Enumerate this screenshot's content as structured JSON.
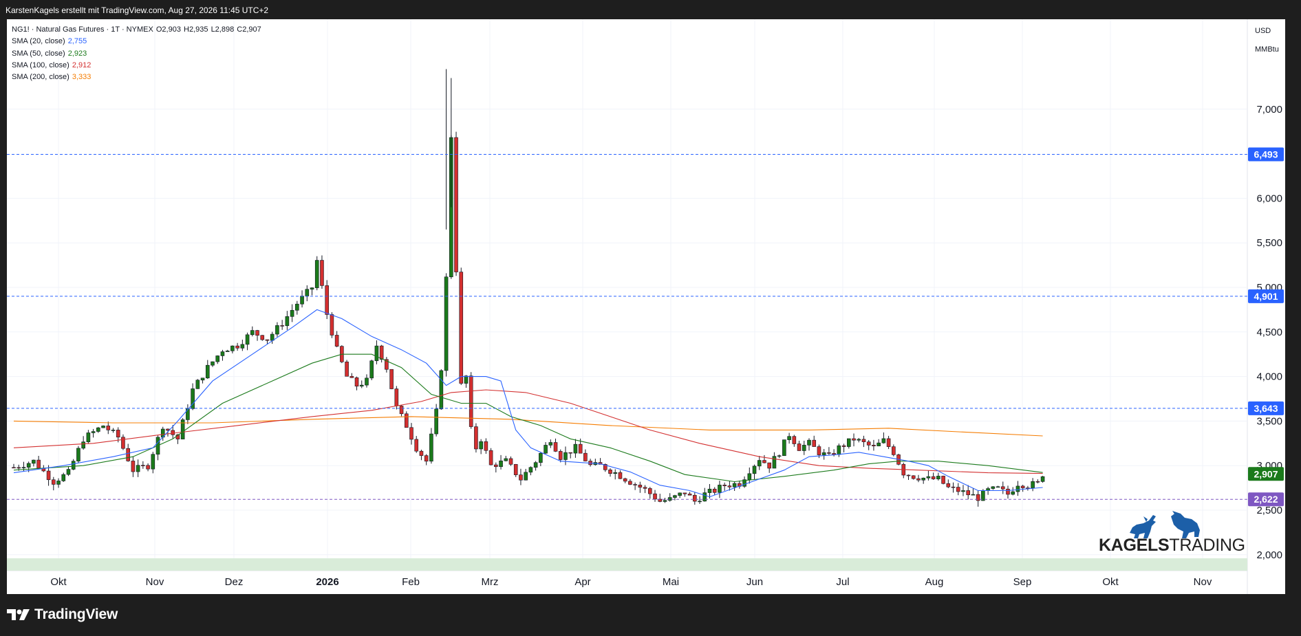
{
  "header": {
    "author_line": "KarstenKagels erstellt mit TradingView.com, Aug 27, 2026 11:45 UTC+2"
  },
  "legend": {
    "symbol": "NG1! · Natural Gas Futures · 1T · NYMEX",
    "open": "O2,903",
    "high": "H2,935",
    "low": "L2,898",
    "close": "C2,907",
    "sma": [
      {
        "label": "SMA (20, close)",
        "value": "2,755",
        "color": "#2962ff"
      },
      {
        "label": "SMA (50, close)",
        "value": "2,923",
        "color": "#1b7a1b"
      },
      {
        "label": "SMA (100, close)",
        "value": "2,912",
        "color": "#d32f2f"
      },
      {
        "label": "SMA (200, close)",
        "value": "3,333",
        "color": "#f57c00"
      }
    ]
  },
  "price_axis": {
    "currency": "USD",
    "unit": "MMBtu",
    "ticks": [
      "2,000",
      "2,500",
      "3,000",
      "3,500",
      "4,000",
      "4,500",
      "5,000",
      "5,500",
      "6,000",
      "7,000"
    ]
  },
  "time_axis": {
    "labels": [
      "Okt",
      "Nov",
      "Dez",
      "2026",
      "Feb",
      "Mrz",
      "Apr",
      "Mai",
      "Jun",
      "Jul",
      "Aug",
      "Sep",
      "Okt",
      "Nov"
    ]
  },
  "horizontal_levels": [
    {
      "value": 6.493,
      "label": "6,493",
      "color": "#2962ff"
    },
    {
      "value": 4.901,
      "label": "4,901",
      "color": "#2962ff"
    },
    {
      "value": 3.643,
      "label": "3,643",
      "color": "#2962ff"
    },
    {
      "value": 2.622,
      "label": "2,622",
      "color": "#7e57c2"
    }
  ],
  "last_price": {
    "value": 2.907,
    "label": "2,907",
    "color": "#1b7a1b"
  },
  "watermark": {
    "brand": "KAGELS",
    "suffix": "TRADING"
  },
  "footer": {
    "brand": "TradingView"
  },
  "chart_data": {
    "type": "candlestick",
    "title": "NG1! · Natural Gas Futures · 1T · NYMEX",
    "x_axis": "time",
    "y_axis": "price",
    "ylim": [
      1.9,
      7.9
    ],
    "scale": "linear",
    "grid": true,
    "up_color": "#1b7a1b",
    "down_color": "#d32f2f",
    "close_path": [
      [
        0,
        2.98
      ],
      [
        4,
        3.05
      ],
      [
        8,
        2.82
      ],
      [
        11,
        2.92
      ],
      [
        14,
        3.3
      ],
      [
        18,
        3.45
      ],
      [
        21,
        3.32
      ],
      [
        24,
        2.95
      ],
      [
        27,
        3.0
      ],
      [
        30,
        3.45
      ],
      [
        33,
        3.3
      ],
      [
        36,
        3.85
      ],
      [
        39,
        4.1
      ],
      [
        42,
        4.3
      ],
      [
        45,
        4.35
      ],
      [
        48,
        4.5
      ],
      [
        51,
        4.42
      ],
      [
        54,
        4.6
      ],
      [
        57,
        4.82
      ],
      [
        60,
        5.0
      ],
      [
        61,
        5.3
      ],
      [
        63,
        4.7
      ],
      [
        65,
        4.3
      ],
      [
        67,
        4.0
      ],
      [
        69,
        3.9
      ],
      [
        71,
        3.95
      ],
      [
        73,
        4.35
      ],
      [
        75,
        4.1
      ],
      [
        77,
        3.65
      ],
      [
        79,
        3.45
      ],
      [
        81,
        3.2
      ],
      [
        83,
        3.05
      ],
      [
        85,
        3.6
      ],
      [
        86,
        4.1
      ],
      [
        87,
        5.1
      ],
      [
        88,
        6.7
      ],
      [
        89,
        5.2
      ],
      [
        90,
        3.9
      ],
      [
        91,
        4.0
      ],
      [
        92,
        3.4
      ],
      [
        93,
        3.2
      ],
      [
        94,
        3.3
      ],
      [
        96,
        3.0
      ],
      [
        99,
        3.05
      ],
      [
        102,
        2.85
      ],
      [
        105,
        3.05
      ],
      [
        108,
        3.3
      ],
      [
        110,
        3.1
      ],
      [
        113,
        3.2
      ],
      [
        116,
        3.0
      ],
      [
        118,
        3.0
      ],
      [
        121,
        2.92
      ],
      [
        124,
        2.82
      ],
      [
        127,
        2.73
      ],
      [
        130,
        2.6
      ],
      [
        132,
        2.62
      ],
      [
        135,
        2.7
      ],
      [
        137,
        2.6
      ],
      [
        139,
        2.68
      ],
      [
        141,
        2.72
      ],
      [
        143,
        2.78
      ],
      [
        146,
        2.8
      ],
      [
        148,
        2.95
      ],
      [
        150,
        3.08
      ],
      [
        152,
        3.0
      ],
      [
        154,
        3.15
      ],
      [
        156,
        3.35
      ],
      [
        158,
        3.2
      ],
      [
        160,
        3.25
      ],
      [
        162,
        3.15
      ],
      [
        164,
        3.1
      ],
      [
        166,
        3.2
      ],
      [
        169,
        3.3
      ],
      [
        171,
        3.25
      ],
      [
        173,
        3.2
      ],
      [
        175,
        3.28
      ],
      [
        177,
        3.15
      ],
      [
        179,
        2.92
      ],
      [
        181,
        2.88
      ],
      [
        184,
        2.85
      ],
      [
        186,
        2.85
      ],
      [
        188,
        2.75
      ],
      [
        190,
        2.72
      ],
      [
        192,
        2.68
      ],
      [
        194,
        2.64
      ],
      [
        196,
        2.72
      ],
      [
        198,
        2.74
      ],
      [
        200,
        2.68
      ],
      [
        202,
        2.8
      ],
      [
        204,
        2.78
      ],
      [
        206,
        2.8
      ],
      [
        207,
        2.907
      ]
    ],
    "sma_20": [
      [
        0,
        2.92
      ],
      [
        10,
        3.0
      ],
      [
        20,
        3.1
      ],
      [
        28,
        3.2
      ],
      [
        33,
        3.5
      ],
      [
        40,
        3.95
      ],
      [
        48,
        4.25
      ],
      [
        56,
        4.55
      ],
      [
        61,
        4.75
      ],
      [
        66,
        4.65
      ],
      [
        72,
        4.45
      ],
      [
        78,
        4.3
      ],
      [
        83,
        4.15
      ],
      [
        87,
        3.9
      ],
      [
        90,
        4.0
      ],
      [
        95,
        4.0
      ],
      [
        98,
        3.95
      ],
      [
        101,
        3.4
      ],
      [
        104,
        3.2
      ],
      [
        110,
        3.05
      ],
      [
        118,
        3.02
      ],
      [
        124,
        2.93
      ],
      [
        130,
        2.78
      ],
      [
        136,
        2.72
      ],
      [
        140,
        2.65
      ],
      [
        145,
        2.75
      ],
      [
        150,
        2.85
      ],
      [
        155,
        2.95
      ],
      [
        160,
        3.1
      ],
      [
        165,
        3.12
      ],
      [
        170,
        3.15
      ],
      [
        175,
        3.1
      ],
      [
        180,
        3.05
      ],
      [
        184,
        3.0
      ],
      [
        188,
        2.88
      ],
      [
        194,
        2.72
      ],
      [
        200,
        2.72
      ],
      [
        207,
        2.755
      ]
    ],
    "sma_50": [
      [
        0,
        2.95
      ],
      [
        14,
        3.0
      ],
      [
        24,
        3.1
      ],
      [
        32,
        3.3
      ],
      [
        42,
        3.7
      ],
      [
        52,
        3.95
      ],
      [
        60,
        4.15
      ],
      [
        66,
        4.25
      ],
      [
        72,
        4.25
      ],
      [
        78,
        4.1
      ],
      [
        84,
        3.8
      ],
      [
        90,
        3.7
      ],
      [
        95,
        3.7
      ],
      [
        100,
        3.55
      ],
      [
        106,
        3.45
      ],
      [
        112,
        3.3
      ],
      [
        120,
        3.2
      ],
      [
        128,
        3.05
      ],
      [
        135,
        2.9
      ],
      [
        145,
        2.82
      ],
      [
        155,
        2.88
      ],
      [
        165,
        2.95
      ],
      [
        172,
        3.02
      ],
      [
        178,
        3.05
      ],
      [
        186,
        3.05
      ],
      [
        196,
        3.0
      ],
      [
        207,
        2.923
      ]
    ],
    "sma_100": [
      [
        0,
        3.2
      ],
      [
        16,
        3.25
      ],
      [
        30,
        3.35
      ],
      [
        45,
        3.45
      ],
      [
        60,
        3.55
      ],
      [
        72,
        3.62
      ],
      [
        82,
        3.72
      ],
      [
        88,
        3.82
      ],
      [
        95,
        3.85
      ],
      [
        103,
        3.82
      ],
      [
        112,
        3.7
      ],
      [
        120,
        3.55
      ],
      [
        128,
        3.4
      ],
      [
        138,
        3.25
      ],
      [
        150,
        3.1
      ],
      [
        162,
        3.0
      ],
      [
        172,
        2.97
      ],
      [
        182,
        2.95
      ],
      [
        196,
        2.92
      ],
      [
        207,
        2.912
      ]
    ],
    "sma_200": [
      [
        0,
        3.5
      ],
      [
        20,
        3.48
      ],
      [
        40,
        3.48
      ],
      [
        60,
        3.52
      ],
      [
        80,
        3.55
      ],
      [
        100,
        3.52
      ],
      [
        120,
        3.45
      ],
      [
        140,
        3.4
      ],
      [
        160,
        3.4
      ],
      [
        176,
        3.42
      ],
      [
        190,
        3.38
      ],
      [
        207,
        3.333
      ]
    ],
    "month_positions": {
      "Okt": 7,
      "Nov": 23,
      "Dez": 38,
      "2026": 53,
      "Feb": 67,
      "Mrz": 80,
      "Apr": 95,
      "Mai": 109,
      "Jun": 123,
      "Jul": 137,
      "Aug": 152,
      "Sep": 166,
      "Okt2": 181,
      "Nov2": 196
    },
    "plot_x_range": [
      0,
      202
    ]
  }
}
